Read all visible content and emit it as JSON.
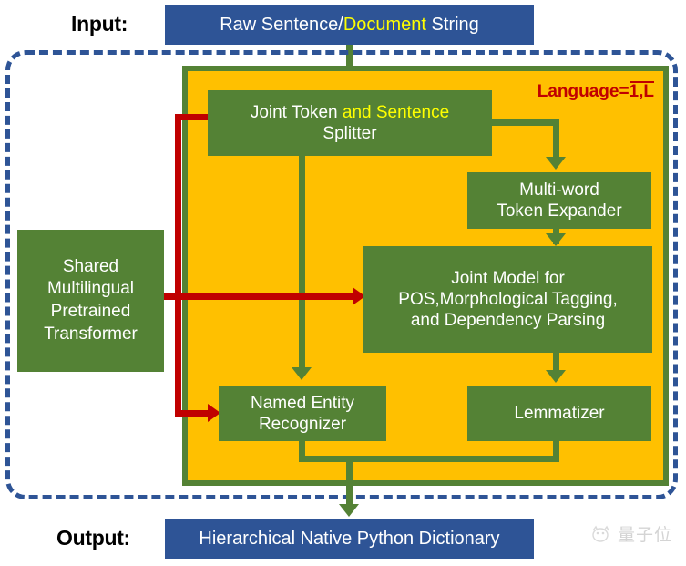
{
  "io": {
    "input_label": "Input:",
    "output_label": "Output:",
    "input_text_before": "Raw Sentence/",
    "input_text_highlight": "Document",
    "input_text_after": " String",
    "output_text": "Hierarchical Native Python Dictionary"
  },
  "panel": {
    "language_label_prefix": "Language=",
    "language_label_range": "1,L"
  },
  "boxes": {
    "splitter": {
      "line1_before": "Joint Token ",
      "line1_highlight": "and Sentence",
      "line2": "Splitter"
    },
    "mwt": {
      "line1": "Multi-word",
      "line2": "Token Expander"
    },
    "joint_model": {
      "line1": "Joint Model for",
      "line2": "POS,Morphological Tagging,",
      "line3": "and Dependency Parsing"
    },
    "ner": {
      "line1": "Named Entity",
      "line2": "Recognizer"
    },
    "lemmatizer": {
      "line1": "Lemmatizer"
    },
    "transformer": {
      "line1": "Shared",
      "line2": "Multilingual",
      "line3": "Pretrained",
      "line4": "Transformer"
    }
  },
  "watermark": {
    "text": "量子位"
  },
  "colors": {
    "process_green": "#548235",
    "panel_yellow": "#ffc000",
    "io_blue": "#2e5496",
    "arrow_red": "#c00000",
    "highlight_yellow": "#ffff00"
  }
}
